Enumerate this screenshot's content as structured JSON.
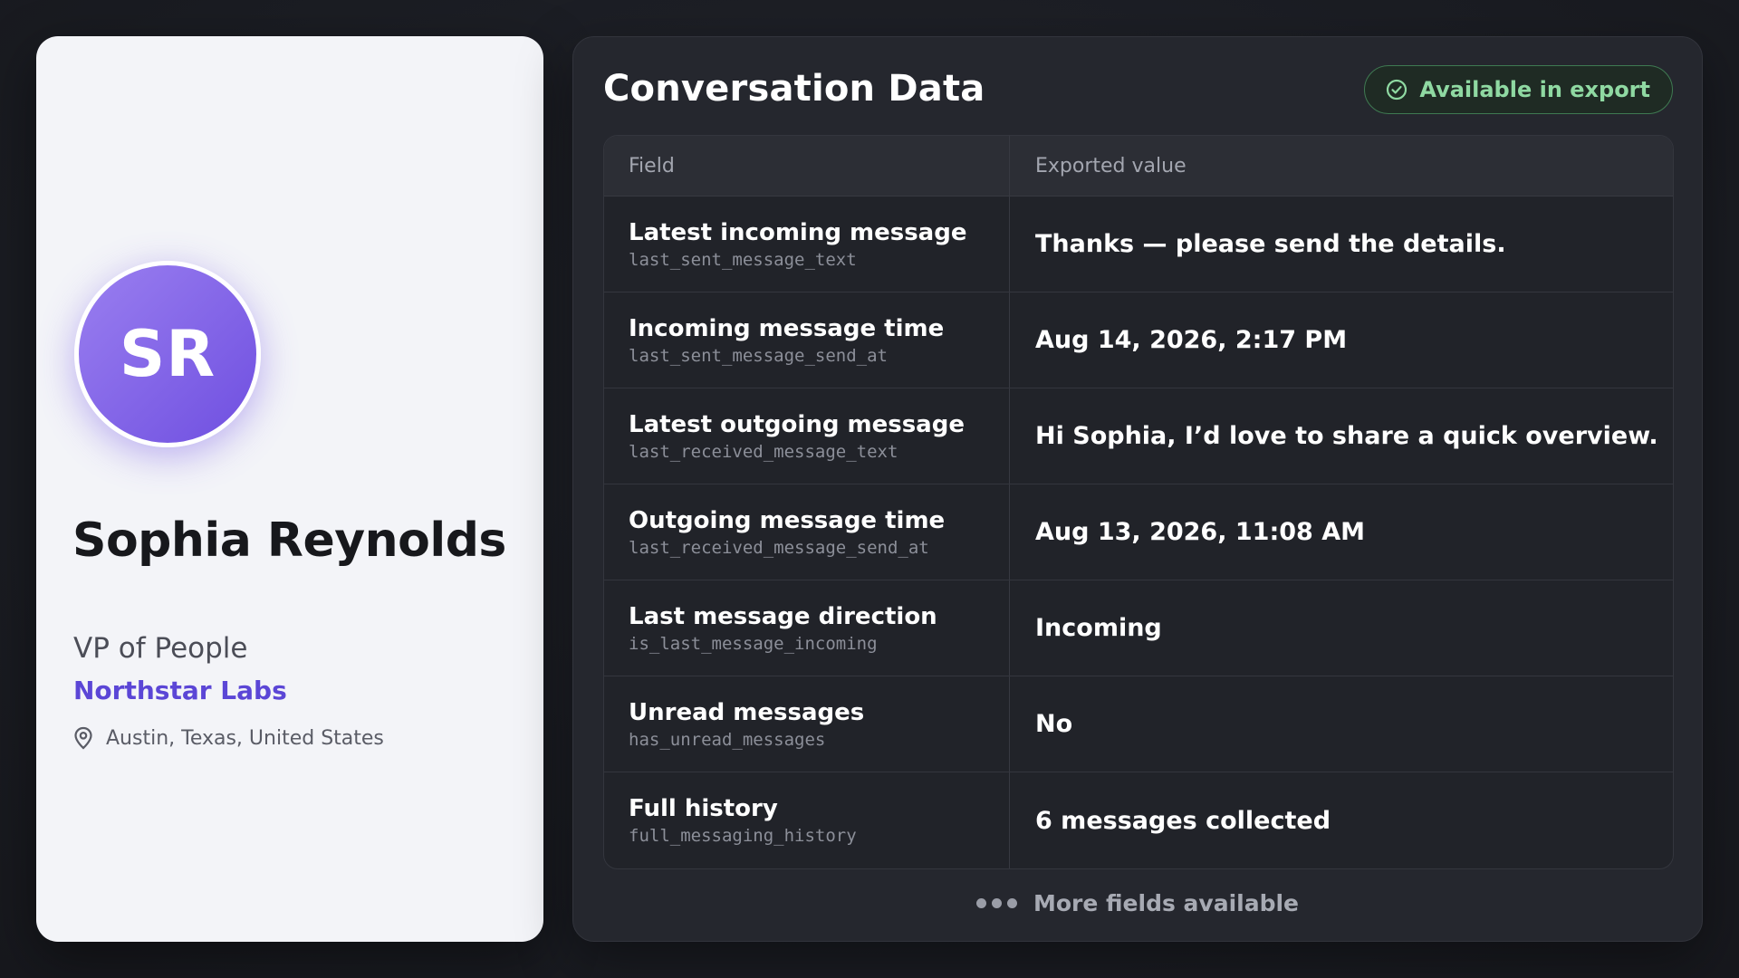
{
  "profile": {
    "initials": "SR",
    "name": "Sophia Reynolds",
    "title": "VP of People",
    "company": "Northstar Labs",
    "location": "Austin, Texas, United States"
  },
  "panel": {
    "title": "Conversation Data",
    "export_badge": "Available in export",
    "columns": [
      "Field",
      "Exported value"
    ],
    "rows": [
      {
        "label": "Latest incoming message",
        "key": "last_sent_message_text",
        "value": "Thanks — please send the details."
      },
      {
        "label": "Incoming message time",
        "key": "last_sent_message_send_at",
        "value": "Aug 14, 2026, 2:17 PM"
      },
      {
        "label": "Latest outgoing message",
        "key": "last_received_message_text",
        "value": "Hi Sophia, I’d love to share a quick overview."
      },
      {
        "label": "Outgoing message time",
        "key": "last_received_message_send_at",
        "value": "Aug 13, 2026, 11:08 AM"
      },
      {
        "label": "Last message direction",
        "key": "is_last_message_incoming",
        "value": "Incoming"
      },
      {
        "label": "Unread messages",
        "key": "has_unread_messages",
        "value": "No"
      },
      {
        "label": "Full history",
        "key": "full_messaging_history",
        "value": "6 messages collected"
      }
    ],
    "more_fields": "More fields available"
  },
  "icons": {
    "location": "map-pin-icon",
    "export": "check-circle-icon",
    "more": "ellipsis-icon"
  },
  "colors": {
    "accent": "#5b46d6",
    "avatar_gradient": [
      "#9a7ff0",
      "#6f4fe0"
    ],
    "success": "#8fd9a2"
  }
}
